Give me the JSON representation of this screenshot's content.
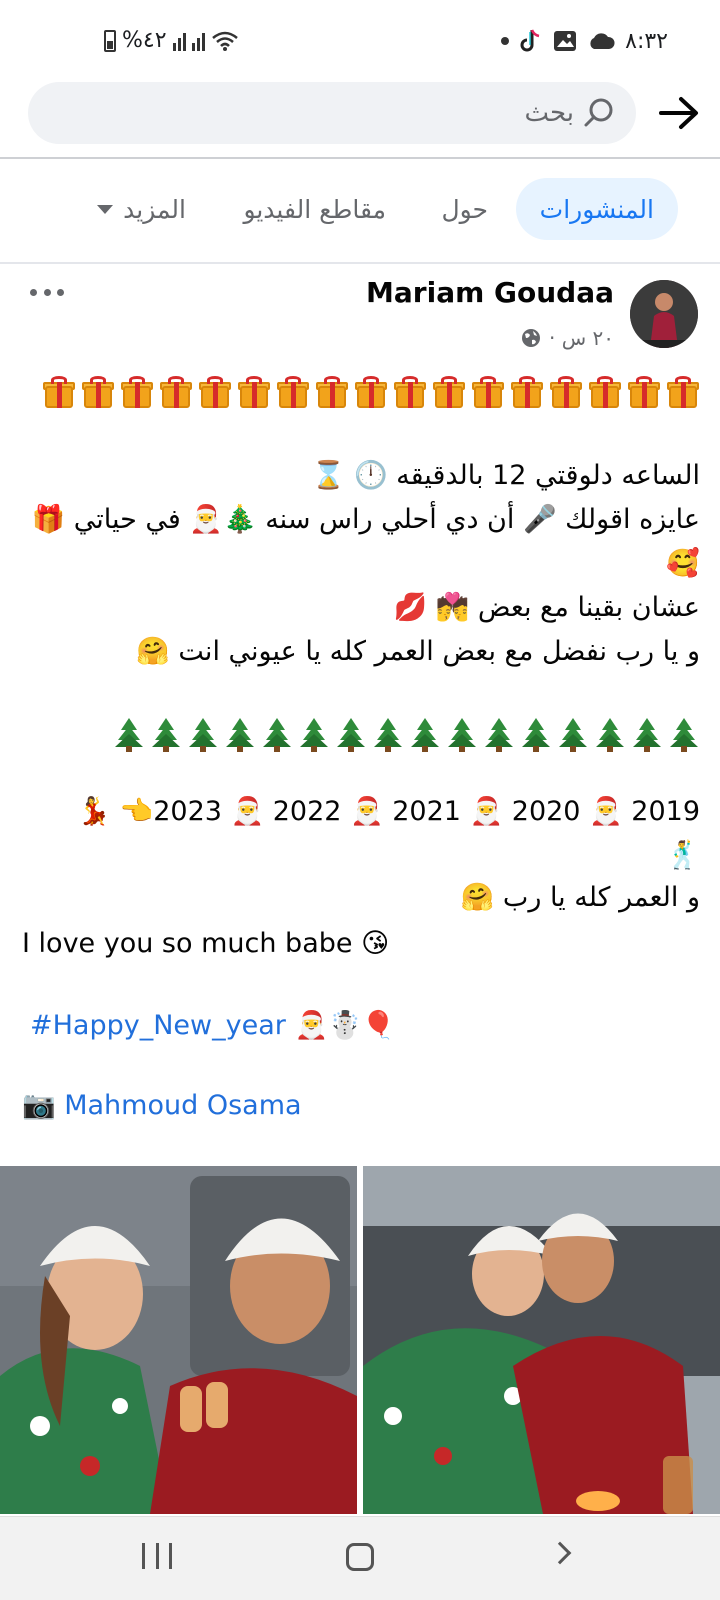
{
  "status_bar": {
    "time": "٨:٣٢",
    "battery": "%٤٢"
  },
  "search": {
    "placeholder": "بحث",
    "value": ""
  },
  "tabs": [
    {
      "label": "المنشورات",
      "active": true
    },
    {
      "label": "حول",
      "active": false
    },
    {
      "label": "مقاطع الفيديو",
      "active": false
    },
    {
      "label": "المزيد",
      "active": false
    }
  ],
  "post": {
    "author": "Mariam Goudaa",
    "time": "٢٠ س ·",
    "lines": {
      "l1": "الساعه دلوقتي 12 بالدقيقه 🕛 ⌛",
      "l2": "عايزه اقولك 🎤 أن دي أحلي راس سنه 🎄🎅 في حياتي 🎁",
      "l3": "🥰",
      "l4": "عشان بقينا مع بعض 💏 💋",
      "l5": "و يا رب نفضل مع بعض العمر كله يا عيوني انت 🤗",
      "l6": "2019 🎅 2020 🎅 2021 🎅 2022 🎅 2023👈 💃",
      "l7": "🕺",
      "l8": "و العمر كله يا رب 🤗",
      "l9": "I love you so much babe 😘",
      "hashtag": "#Happy_New_year",
      "hashtag_emoji": "🎅☃️🎈",
      "camera": "📷",
      "mention": "Mahmoud Osama"
    },
    "gift_count": 17,
    "tree_count": 16
  },
  "colors": {
    "accent": "#1877f2",
    "link": "#216fdb",
    "tab_active_bg": "#e7f3ff",
    "muted": "#65676b"
  }
}
